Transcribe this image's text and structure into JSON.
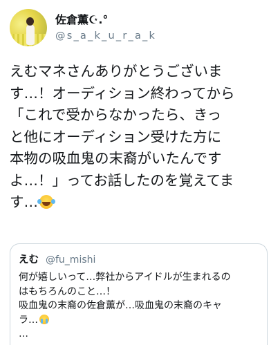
{
  "author": {
    "display_name": "佐倉薫☪︎.°",
    "handle": "@s_a_k_u_r_a_k"
  },
  "tweet": {
    "lines": [
      "えむマネさんありがとうございま",
      "す…！オーディション終わってから",
      "「これで受からなかったら、きっ",
      "と他にオーディション受けた方に",
      "本物の吸血鬼の末裔がいたんです",
      "よ…！」ってお話したのを覚えてま",
      "す…"
    ],
    "trailing_emoji": "face-with-tears-of-joy-icon"
  },
  "quoted_tweet": {
    "display_name": "えむ",
    "handle": "@fu_mishi",
    "lines": [
      "何が嬉しいって…弊社からアイドルが生まれるの",
      "はもちろんのこと…！",
      "吸血鬼の末裔の佐倉薫が…吸血鬼の末裔のキャ",
      "ラ…",
      "…"
    ],
    "emoji_after_line_4": "loudly-crying-face-icon"
  },
  "colors": {
    "text_primary": "#14171a",
    "text_secondary": "#657786",
    "card_border": "#ccd6dd",
    "background": "#ffffff"
  }
}
